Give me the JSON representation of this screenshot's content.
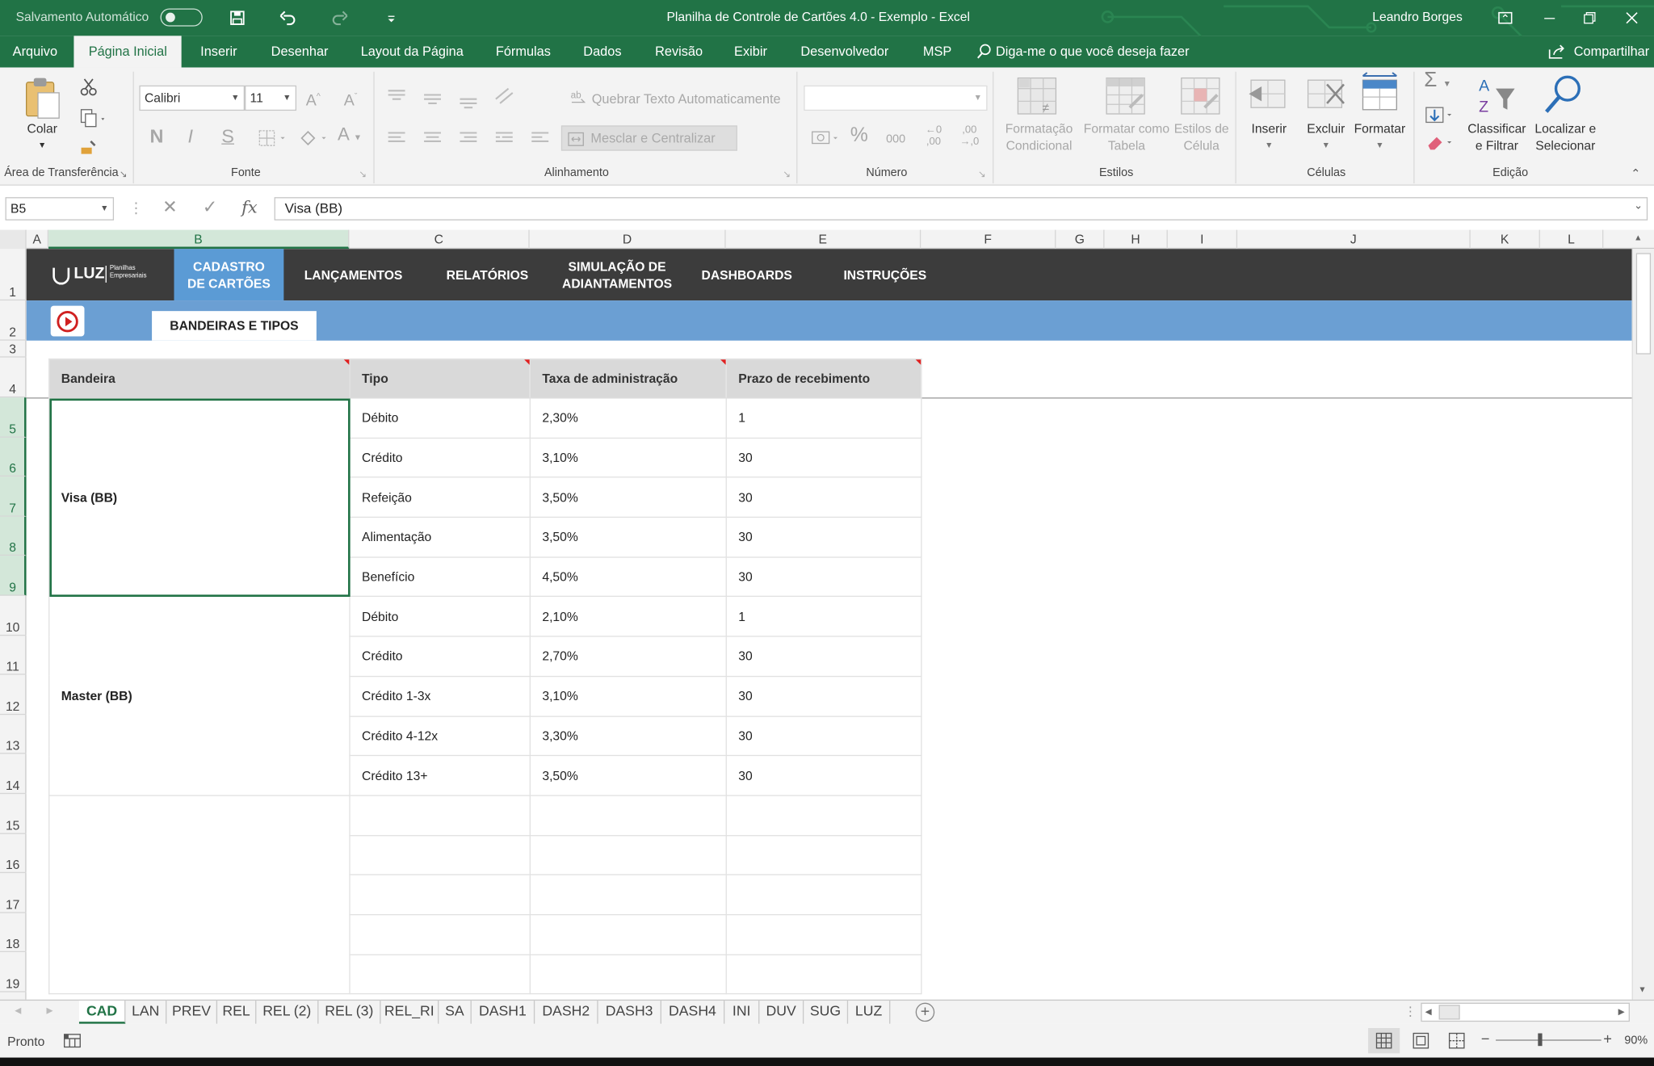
{
  "titlebar": {
    "autosave_label": "Salvamento Automático",
    "doc_title": "Planilha de Controle de Cartões 4.0 - Exemplo  -  Excel",
    "user_name": "Leandro Borges"
  },
  "menu": {
    "tabs": [
      "Arquivo",
      "Página Inicial",
      "Inserir",
      "Desenhar",
      "Layout da Página",
      "Fórmulas",
      "Dados",
      "Revisão",
      "Exibir",
      "Desenvolvedor",
      "MSP"
    ],
    "tell_me": "Diga-me o que você deseja fazer",
    "share": "Compartilhar"
  },
  "ribbon": {
    "clipboard": {
      "paste": "Colar",
      "label": "Área de Transferência"
    },
    "font": {
      "name": "Calibri",
      "size": "11",
      "bold": "N",
      "italic": "I",
      "underline": "S",
      "label": "Fonte"
    },
    "alignment": {
      "wrap": "Quebrar Texto Automaticamente",
      "merge": "Mesclar e Centralizar",
      "label": "Alinhamento"
    },
    "number": {
      "format": "",
      "percent": "%",
      "thousands": "000",
      "inc_decimal": "⁺⁰,00",
      "dec_decimal": ",00→,0",
      "label": "Número"
    },
    "styles": {
      "conditional": "Formatação\nCondicional",
      "as_table": "Formatar como\nTabela",
      "cell_styles": "Estilos de\nCélula",
      "label": "Estilos"
    },
    "cells": {
      "insert": "Inserir",
      "delete": "Excluir",
      "format": "Formatar",
      "label": "Células"
    },
    "editing": {
      "sort": "Classificar\ne Filtrar",
      "find": "Localizar e\nSelecionar",
      "label": "Edição"
    }
  },
  "formula_bar": {
    "name_box": "B5",
    "content": "Visa (BB)"
  },
  "columns": [
    "A",
    "B",
    "C",
    "D",
    "E",
    "F",
    "G",
    "H",
    "I",
    "J",
    "K",
    "L"
  ],
  "rows": [
    "1",
    "2",
    "3",
    "4",
    "5",
    "6",
    "7",
    "8",
    "9",
    "10",
    "11",
    "12",
    "13",
    "14",
    "15",
    "16",
    "17",
    "18",
    "19"
  ],
  "app_nav": {
    "logo": "LUZ",
    "logo_sub": "Planilhas Empresariais",
    "items": [
      "CADASTRO\nDE CARTÕES",
      "LANÇAMENTOS",
      "RELATÓRIOS",
      "SIMULAÇÃO DE\nADIANTAMENTOS",
      "DASHBOARDS",
      "INSTRUÇÕES"
    ],
    "sub_tab": "BANDEIRAS E TIPOS"
  },
  "table": {
    "headers": [
      "Bandeira",
      "Tipo",
      "Taxa de administração",
      "Prazo de recebimento"
    ],
    "groups": [
      {
        "bandeira": "Visa (BB)",
        "rows": [
          {
            "tipo": "Débito",
            "taxa": "2,30%",
            "prazo": "1"
          },
          {
            "tipo": "Crédito",
            "taxa": "3,10%",
            "prazo": "30"
          },
          {
            "tipo": "Refeição",
            "taxa": "3,50%",
            "prazo": "30"
          },
          {
            "tipo": "Alimentação",
            "taxa": "3,50%",
            "prazo": "30"
          },
          {
            "tipo": "Benefício",
            "taxa": "4,50%",
            "prazo": "30"
          }
        ]
      },
      {
        "bandeira": "Master (BB)",
        "rows": [
          {
            "tipo": "Débito",
            "taxa": "2,10%",
            "prazo": "1"
          },
          {
            "tipo": "Crédito",
            "taxa": "2,70%",
            "prazo": "30"
          },
          {
            "tipo": "Crédito 1-3x",
            "taxa": "3,10%",
            "prazo": "30"
          },
          {
            "tipo": "Crédito 4-12x",
            "taxa": "3,30%",
            "prazo": "30"
          },
          {
            "tipo": "Crédito 13+",
            "taxa": "3,50%",
            "prazo": "30"
          }
        ]
      }
    ]
  },
  "sheet_tabs": [
    "CAD",
    "LAN",
    "PREV",
    "REL",
    "REL (2)",
    "REL (3)",
    "REL_RI",
    "SA",
    "DASH1",
    "DASH2",
    "DASH3",
    "DASH4",
    "INI",
    "DUV",
    "SUG",
    "LUZ"
  ],
  "status": {
    "ready": "Pronto",
    "zoom": "90%"
  },
  "colors": {
    "excel_green": "#217346",
    "nav_dark": "#3c3c3c",
    "nav_active": "#5b9bd5",
    "sub_bar": "#6b9fd3"
  }
}
